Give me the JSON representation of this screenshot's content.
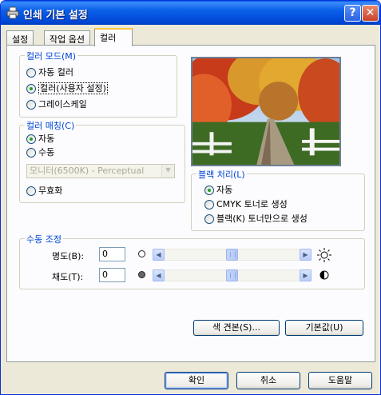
{
  "window": {
    "title": "인쇄 기본 설정",
    "icon": "printer-icon",
    "help_glyph": "?",
    "close_glyph": "✕"
  },
  "tabs": [
    {
      "label": "설정",
      "active": false
    },
    {
      "label": "작업 옵션",
      "active": false
    },
    {
      "label": "컬러",
      "active": true
    }
  ],
  "color_mode": {
    "label": "컬러 모드(M)",
    "options": [
      {
        "label": "자동 컬러",
        "checked": false
      },
      {
        "label": "컬러(사용자 설정)",
        "checked": true
      },
      {
        "label": "그레이스케일",
        "checked": false
      }
    ]
  },
  "color_matching": {
    "label": "컬러 매칭(C)",
    "options": [
      {
        "label": "자동",
        "checked": true
      },
      {
        "label": "수동",
        "checked": false
      },
      {
        "label": "무효화",
        "checked": false
      }
    ],
    "profile_select": "모니터(6500K) - Perceptual"
  },
  "black_processing": {
    "label": "블랙 처리(L)",
    "options": [
      {
        "label": "자동",
        "checked": true
      },
      {
        "label": "CMYK 토너로 생성",
        "checked": false
      },
      {
        "label": "블랙(K) 토너만으로 생성",
        "checked": false
      }
    ]
  },
  "manual_adjust": {
    "label": "수동 조정",
    "brightness": {
      "label": "명도(B):",
      "value": "0",
      "position": 0.5,
      "icon": "sun-icon"
    },
    "saturation": {
      "label": "채도(T):",
      "value": "0",
      "position": 0.5,
      "icon": "contrast-icon"
    }
  },
  "buttons": {
    "color_sample": "색 견본(S)...",
    "default": "기본값(U)",
    "ok": "확인",
    "cancel": "취소",
    "help": "도움말"
  },
  "colors": {
    "title_bar": "#0A5FE8",
    "group_label": "#0046D5",
    "face": "#ECE9D8"
  }
}
